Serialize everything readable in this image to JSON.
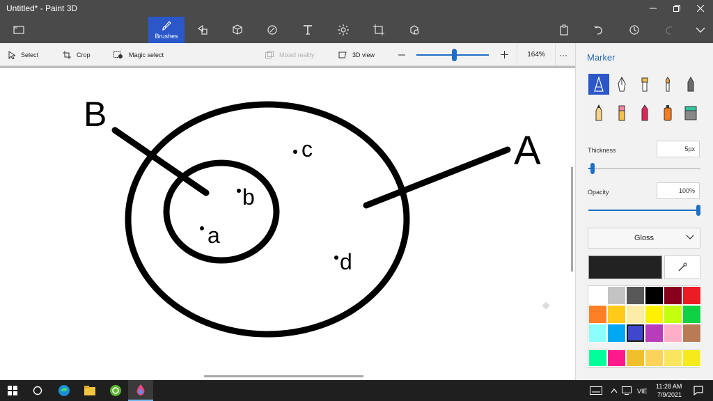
{
  "window": {
    "title": "Untitled* - Paint 3D"
  },
  "toolbar": {
    "brushes_label": "Brushes"
  },
  "subtoolbar": {
    "select": "Select",
    "crop": "Crop",
    "magic_select": "Magic select",
    "mixed_reality": "Mixed reality",
    "view_3d": "3D view",
    "zoom": "164%",
    "more": "···"
  },
  "canvas": {
    "labels": {
      "A": "A",
      "B": "B",
      "a": "a",
      "b": "b",
      "c": "c",
      "d": "d"
    },
    "stroke_color": "#000000"
  },
  "panel": {
    "title": "Marker",
    "thickness_label": "Thickness",
    "thickness_value": "5px",
    "thickness_level_pct": 4,
    "opacity_label": "Opacity",
    "opacity_value": "100%",
    "opacity_level_pct": 100,
    "finish": "Gloss",
    "current_color": "#222222",
    "palette": [
      "#ffffff",
      "#c3c3c3",
      "#585858",
      "#000000",
      "#88001b",
      "#ec1c24",
      "#ff7f27",
      "#ffca18",
      "#fdeca6",
      "#fff200",
      "#c4ff0e",
      "#0ed145",
      "#8cfffb",
      "#00a8f3",
      "#3f48cc",
      "#b83dba",
      "#ffaec8",
      "#b97a56"
    ],
    "palette_selected": "#3f48cc",
    "palette_extra": [
      "#00ff99",
      "#ff1a8c",
      "#f0c02c",
      "#fcd35a",
      "#f9e55e",
      "#f4ea1c"
    ]
  },
  "taskbar": {
    "language": "VIE",
    "time": "11:28 AM",
    "date": "7/9/2021"
  }
}
